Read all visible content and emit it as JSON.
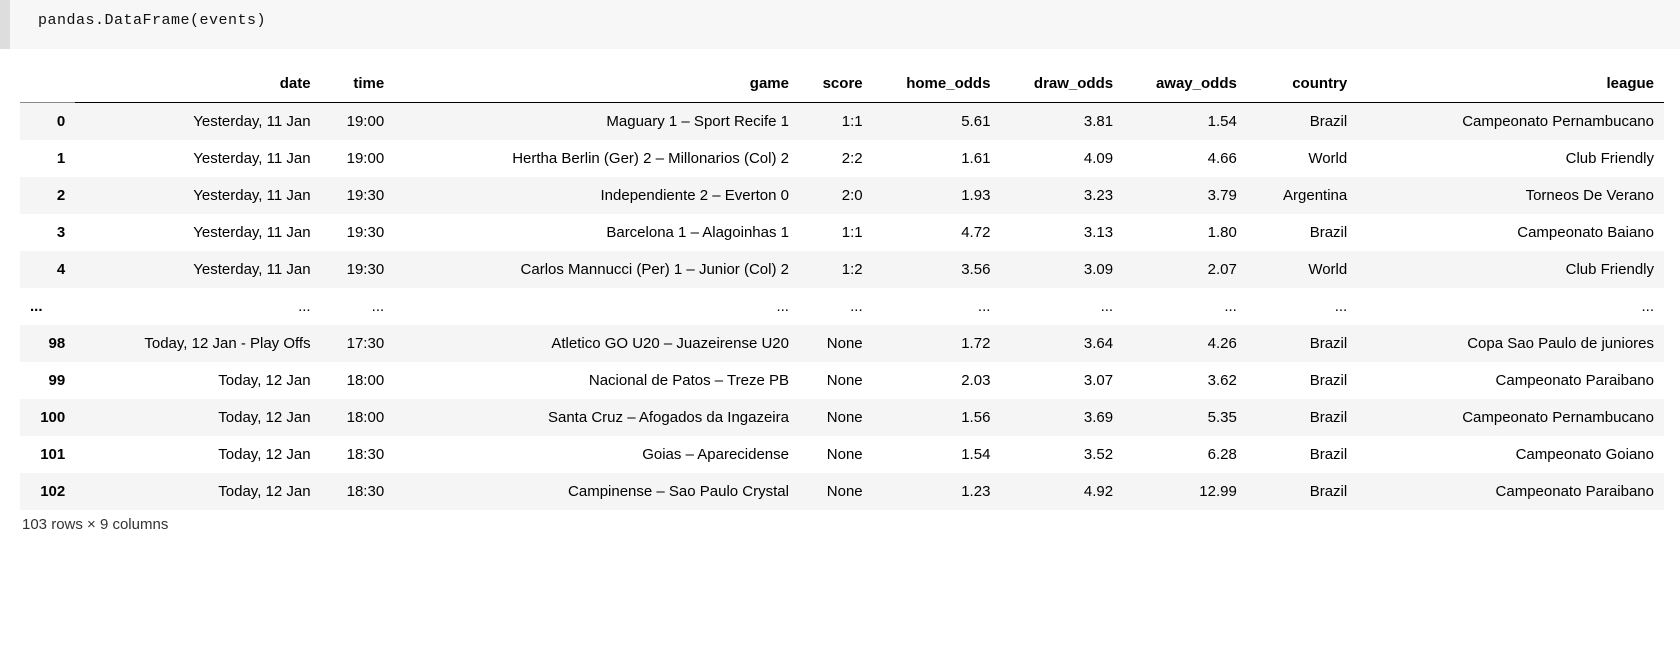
{
  "input": {
    "code": "pandas.DataFrame(events)"
  },
  "table": {
    "columns": [
      "date",
      "time",
      "game",
      "score",
      "home_odds",
      "draw_odds",
      "away_odds",
      "country",
      "league"
    ],
    "ellipsis": "...",
    "top_indices": [
      "0",
      "1",
      "2",
      "3",
      "4"
    ],
    "top_rows": [
      [
        "Yesterday, 11 Jan",
        "19:00",
        "Maguary 1 – Sport Recife 1",
        "1:1",
        "5.61",
        "3.81",
        "1.54",
        "Brazil",
        "Campeonato Pernambucano"
      ],
      [
        "Yesterday, 11 Jan",
        "19:00",
        "Hertha Berlin (Ger) 2 – Millonarios (Col) 2",
        "2:2",
        "1.61",
        "4.09",
        "4.66",
        "World",
        "Club Friendly"
      ],
      [
        "Yesterday, 11 Jan",
        "19:30",
        "Independiente 2 – Everton 0",
        "2:0",
        "1.93",
        "3.23",
        "3.79",
        "Argentina",
        "Torneos De Verano"
      ],
      [
        "Yesterday, 11 Jan",
        "19:30",
        "Barcelona 1 – Alagoinhas 1",
        "1:1",
        "4.72",
        "3.13",
        "1.80",
        "Brazil",
        "Campeonato Baiano"
      ],
      [
        "Yesterday, 11 Jan",
        "19:30",
        "Carlos Mannucci (Per) 1 – Junior (Col) 2",
        "1:2",
        "3.56",
        "3.09",
        "2.07",
        "World",
        "Club Friendly"
      ]
    ],
    "bottom_indices": [
      "98",
      "99",
      "100",
      "101",
      "102"
    ],
    "bottom_rows": [
      [
        "Today, 12 Jan - Play Offs",
        "17:30",
        "Atletico GO U20 – Juazeirense U20",
        "None",
        "1.72",
        "3.64",
        "4.26",
        "Brazil",
        "Copa Sao Paulo de juniores"
      ],
      [
        "Today, 12 Jan",
        "18:00",
        "Nacional de Patos – Treze PB",
        "None",
        "2.03",
        "3.07",
        "3.62",
        "Brazil",
        "Campeonato Paraibano"
      ],
      [
        "Today, 12 Jan",
        "18:00",
        "Santa Cruz – Afogados da Ingazeira",
        "None",
        "1.56",
        "3.69",
        "5.35",
        "Brazil",
        "Campeonato Pernambucano"
      ],
      [
        "Today, 12 Jan",
        "18:30",
        "Goias – Aparecidense",
        "None",
        "1.54",
        "3.52",
        "6.28",
        "Brazil",
        "Campeonato Goiano"
      ],
      [
        "Today, 12 Jan",
        "18:30",
        "Campinense – Sao Paulo Crystal",
        "None",
        "1.23",
        "4.92",
        "12.99",
        "Brazil",
        "Campeonato Paraibano"
      ]
    ],
    "summary": "103 rows × 9 columns"
  }
}
